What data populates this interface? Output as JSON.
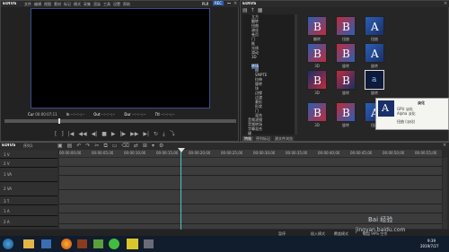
{
  "player": {
    "app_title": "EDIUS",
    "menu": [
      "文件",
      "编辑",
      "视图",
      "素材",
      "标记",
      "模式",
      "采集",
      "渲染",
      "工具",
      "设置",
      "帮助"
    ],
    "mode_plr": "PLR",
    "mode_rec": "REC",
    "tc_labels": [
      "Cur",
      "In",
      "Out",
      "Dur",
      "Ttl"
    ],
    "tc_values": [
      "00:00:07;11",
      "--:--:--;--",
      "--:--:--;--",
      "--:--:--;--",
      "--:--:--;--"
    ]
  },
  "effects": {
    "title": "EDIUS",
    "tree": [
      "立方",
      "翻转",
      "扭曲",
      "溶化",
      "卷页",
      "门",
      "推",
      "光线",
      "滑动",
      "3D",
      "转场",
      "擦",
      "SMPTE",
      "拉伸",
      "旋转",
      "块",
      "边缘",
      "过渡",
      "菱形",
      "形状",
      "门",
      "混合",
      "Alpha"
    ],
    "tree_items_lower": [
      "音频滤镜",
      "音频转场",
      "字幕混合",
      "键"
    ],
    "thumbs": [
      "3D",
      "旋转",
      "滚动",
      "旋转",
      "3D",
      "滑动",
      "旋转",
      "旋转",
      "旋转",
      "翻转",
      "旋转",
      "旋转"
    ],
    "labels_row1": [
      "翻转",
      "扭曲",
      "扭曲",
      "拉伸"
    ],
    "labels_row2": [
      "3D",
      "旋转",
      "旋转",
      "翻转"
    ],
    "labels_row3": [
      "3D",
      "旋转",
      "旋转"
    ],
    "labels_row4": [
      "3D",
      "旋转",
      "扭曲"
    ],
    "tooltip_title": "淡化",
    "tooltip_lines": [
      "GPU 淡化",
      "Alpha 淡化",
      "扭曲 (淡化)"
    ],
    "tabs": [
      "特效",
      "序列标记",
      "源文件浏览"
    ],
    "accent": "#2b5fb5"
  },
  "timeline": {
    "title": "EDIUS",
    "tab": "序列1",
    "ruler": [
      "00:00:00;00",
      "00:00:05;00",
      "00:00:10;00",
      "00:00:15;00",
      "00:00:20;00",
      "00:00:25;00",
      "00:00:30;00",
      "00:00:35;00",
      "00:00:40;00",
      "00:00:45;00",
      "00:00:50;00",
      "00:00:55;00"
    ],
    "tracks": [
      "1 V",
      "2 V",
      "1 VA",
      "2 VA",
      "3 T",
      "1 A",
      "2 A"
    ],
    "status": [
      "暂停",
      "插入模式",
      "覆盖模式"
    ],
    "status_right": "磁盘 99% 空余"
  },
  "taskbar": {
    "time": "9:39",
    "date": "2019/7/27",
    "watermark": "jingyan.baidu.com",
    "brand": "Bai 经验"
  }
}
